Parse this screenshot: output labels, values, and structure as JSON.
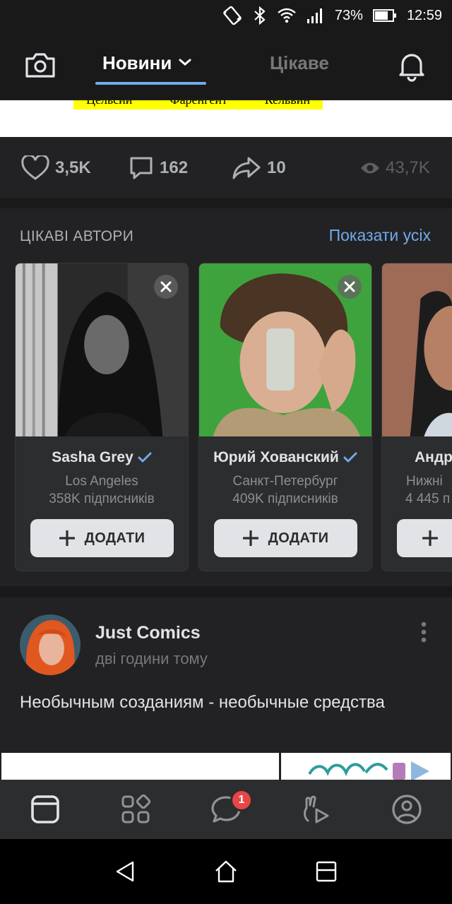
{
  "status_bar": {
    "battery": "73%",
    "time": "12:59"
  },
  "header": {
    "tab_news": "Новини",
    "tab_interesting": "Цікаве"
  },
  "post_image_caption": [
    "Цельсий",
    "Фаренгейт",
    "Кельвин"
  ],
  "post_actions": {
    "likes": "3,5K",
    "comments": "162",
    "shares": "10",
    "views": "43,7K"
  },
  "authors": {
    "heading": "ЦІКАВІ АВТОРИ",
    "show_all": "Показати усіх",
    "cards": [
      {
        "name": "Sasha Grey",
        "city": "Los Angeles",
        "subs": "358K підписників",
        "add": "ДОДАТИ",
        "verified": true
      },
      {
        "name": "Юрий Хованский",
        "city": "Санкт-Петербург",
        "subs": "409K підписників",
        "add": "ДОДАТИ",
        "verified": true
      },
      {
        "name": "Андр",
        "city": "Нижні",
        "subs": "4 445 п",
        "add": "",
        "verified": false
      }
    ]
  },
  "post": {
    "author": "Just Comics",
    "time": "дві години тому",
    "text": "Необычным созданиям - необычные средства"
  },
  "bottom_nav": {
    "messages_badge": "1"
  },
  "colors": {
    "accent": "#71aaeb",
    "badge": "#e64646",
    "background": "#19191a",
    "card": "#2c2d2e"
  }
}
